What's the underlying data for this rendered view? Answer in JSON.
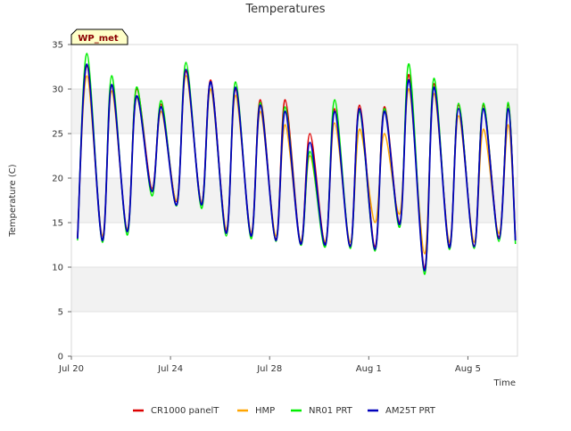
{
  "chart_data": {
    "type": "line",
    "title": "Temperatures",
    "xlabel": "Time",
    "ylabel": "Temperature (C)",
    "site_badge": "WP_met",
    "ylim": [
      0,
      35
    ],
    "xlim": [
      "2023-07-20",
      "2023-08-07"
    ],
    "grid": "horizontal bands",
    "legend_position": "bottom",
    "x_ticks": [
      {
        "date": "2023-07-20",
        "label": "Jul 20"
      },
      {
        "date": "2023-07-24",
        "label": "Jul 24"
      },
      {
        "date": "2023-07-28",
        "label": "Jul 28"
      },
      {
        "date": "2023-08-01",
        "label": "Aug 1"
      },
      {
        "date": "2023-08-05",
        "label": "Aug 5"
      }
    ],
    "y_ticks": [
      0,
      5,
      10,
      15,
      20,
      25,
      30,
      35
    ],
    "series": [
      {
        "name": "CR1000 panelT",
        "color": "#dd0000"
      },
      {
        "name": "HMP",
        "color": "#ffa500"
      },
      {
        "name": "NR01 PRT",
        "color": "#00ee00"
      },
      {
        "name": "AM25T PRT",
        "color": "#0000bb"
      }
    ],
    "x": [
      "2023-07-20 06:00",
      "2023-07-20 15:00",
      "2023-07-21 06:00",
      "2023-07-21 15:00",
      "2023-07-22 06:00",
      "2023-07-22 15:00",
      "2023-07-23 06:00",
      "2023-07-23 15:00",
      "2023-07-24 06:00",
      "2023-07-24 15:00",
      "2023-07-25 06:00",
      "2023-07-25 15:00",
      "2023-07-26 06:00",
      "2023-07-26 15:00",
      "2023-07-27 06:00",
      "2023-07-27 15:00",
      "2023-07-28 06:00",
      "2023-07-28 15:00",
      "2023-07-29 06:00",
      "2023-07-29 15:00",
      "2023-07-30 06:00",
      "2023-07-30 15:00",
      "2023-07-31 06:00",
      "2023-07-31 15:00",
      "2023-08-01 06:00",
      "2023-08-01 15:00",
      "2023-08-02 06:00",
      "2023-08-02 15:00",
      "2023-08-03 06:00",
      "2023-08-03 15:00",
      "2023-08-04 06:00",
      "2023-08-04 15:00",
      "2023-08-05 06:00",
      "2023-08-05 15:00",
      "2023-08-06 06:00",
      "2023-08-06 15:00",
      "2023-08-06 22:00"
    ],
    "values": {
      "AM25T PRT": [
        13.2,
        32.8,
        13.0,
        30.5,
        14.0,
        29.2,
        18.5,
        28.0,
        17.0,
        32.2,
        17.0,
        30.8,
        13.8,
        30.2,
        13.5,
        28.2,
        13.0,
        27.5,
        12.6,
        24.0,
        12.5,
        27.5,
        12.3,
        27.8,
        12.0,
        27.5,
        14.8,
        31.0,
        9.6,
        30.2,
        12.2,
        27.8,
        12.3,
        27.8,
        13.2,
        27.8,
        13.0
      ],
      "CR1000 panelT": [
        13.4,
        32.6,
        13.1,
        30.4,
        14.1,
        30.0,
        18.8,
        28.3,
        17.4,
        32.0,
        17.2,
        31.0,
        14.0,
        30.0,
        13.6,
        28.8,
        13.2,
        28.8,
        12.8,
        25.0,
        12.7,
        27.8,
        12.4,
        28.2,
        12.3,
        28.0,
        15.0,
        31.6,
        9.9,
        30.6,
        12.4,
        28.2,
        12.4,
        28.2,
        13.4,
        28.3,
        13.2
      ],
      "HMP": [
        13.6,
        31.5,
        13.5,
        29.8,
        14.3,
        29.0,
        18.7,
        27.5,
        17.5,
        31.5,
        17.3,
        30.0,
        14.3,
        29.3,
        13.9,
        27.5,
        13.5,
        26.0,
        13.0,
        22.5,
        12.9,
        26.2,
        12.8,
        25.5,
        15.0,
        25.0,
        16.0,
        30.0,
        11.5,
        29.5,
        12.8,
        27.0,
        12.8,
        25.5,
        13.8,
        26.0,
        13.5
      ],
      "NR01 PRT": [
        13.0,
        34.0,
        12.8,
        31.5,
        13.6,
        30.2,
        18.0,
        28.7,
        16.9,
        33.0,
        16.6,
        30.8,
        13.5,
        30.8,
        13.2,
        28.5,
        12.9,
        28.0,
        12.5,
        23.0,
        12.3,
        28.8,
        12.1,
        27.5,
        11.8,
        27.8,
        14.5,
        32.8,
        9.2,
        31.2,
        12.0,
        28.4,
        12.1,
        28.4,
        12.9,
        28.5,
        12.6
      ]
    }
  }
}
